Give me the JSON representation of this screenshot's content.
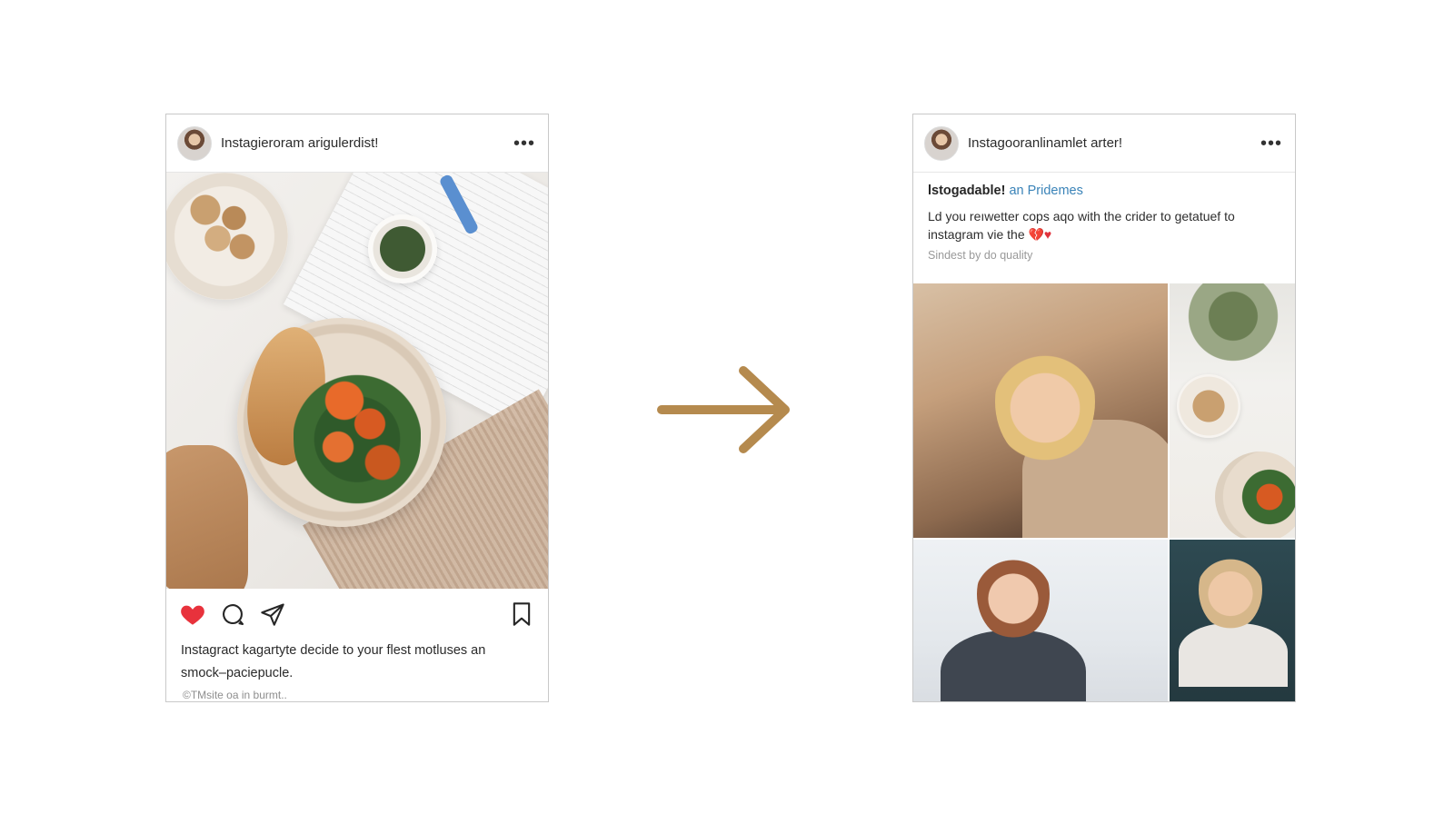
{
  "left_post": {
    "username": "Instagieroram arigulerdist!",
    "more": "•••",
    "caption": "Instagract kagartyte decide to your flest motluses an smock–paciepucle.",
    "subtext": "©TMsite oa in burmt.."
  },
  "right_post": {
    "username": "Instagooranlinamlet arter!",
    "more": "•••",
    "promo_title": "lstogadable!",
    "promo_link": "an Pridemes",
    "promo_text": "Ld you reıwetter cops aqo with the crider to getatuef to instagram vie the",
    "promo_emoji": "💔♥",
    "promo_meta": "Sindest by do quality"
  },
  "colors": {
    "like": "#e8323c",
    "arrow": "#b58a4e",
    "link": "#3a83b8"
  },
  "icons": [
    "heart-icon",
    "comment-icon",
    "share-icon",
    "bookmark-icon",
    "arrow-right-icon",
    "more-icon"
  ]
}
